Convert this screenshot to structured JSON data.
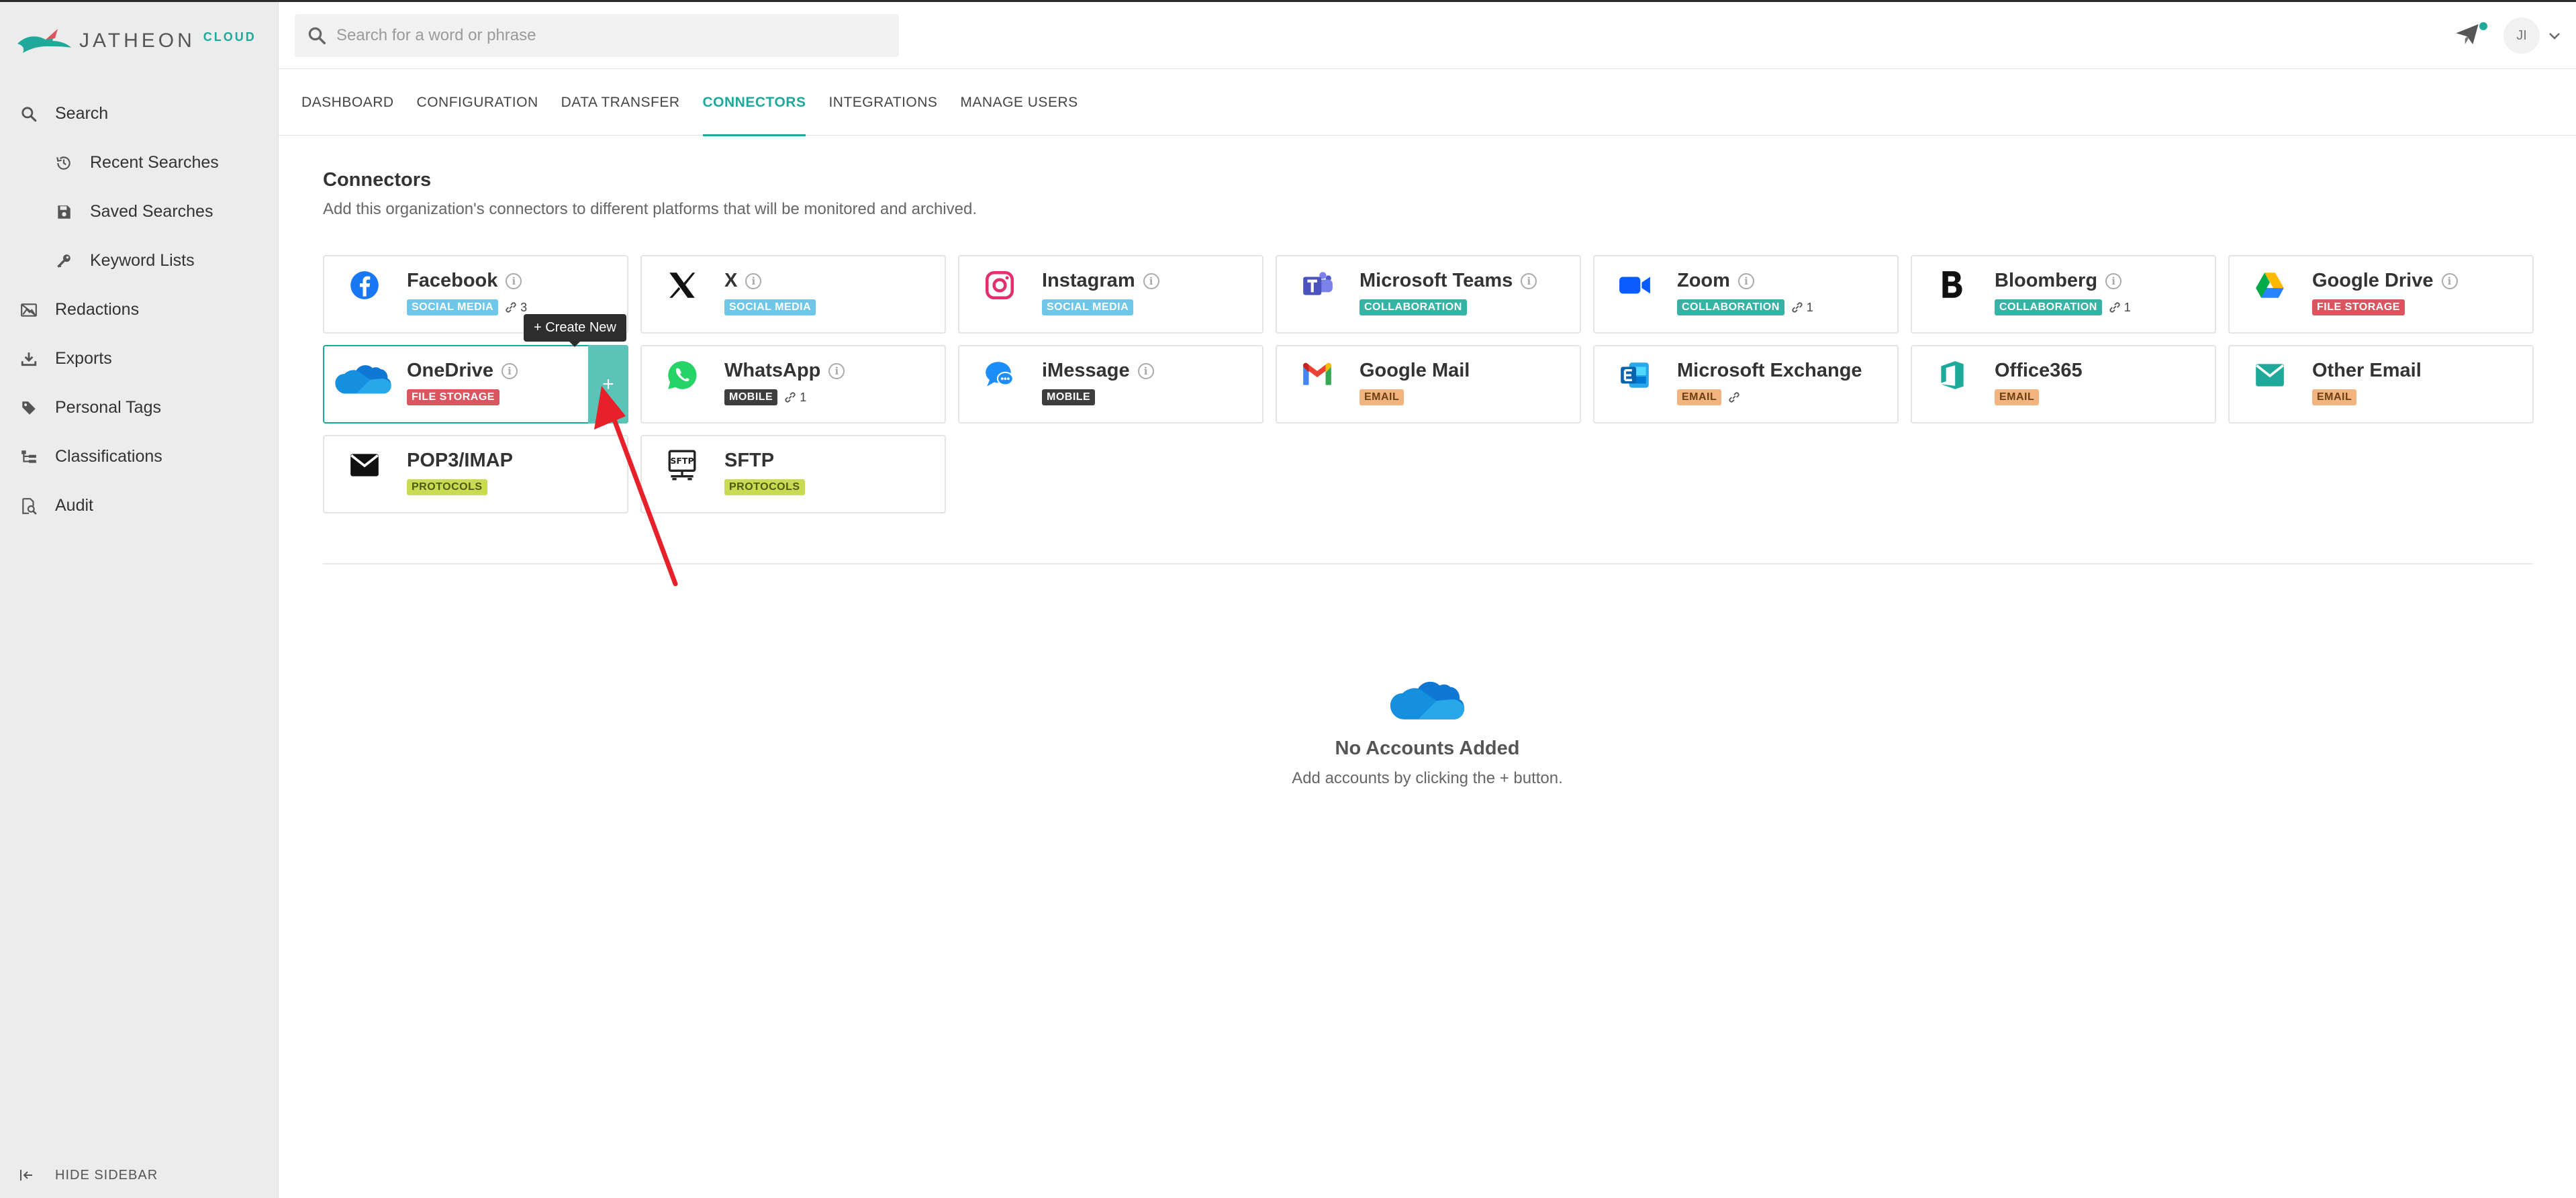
{
  "app": {
    "logo_text": "JATHEON",
    "logo_suffix": "CLOUD"
  },
  "header": {
    "search_placeholder": "Search for a word or phrase",
    "avatar_initials": "JI"
  },
  "sidebar": {
    "items": [
      {
        "label": "Search",
        "icon": "search-icon"
      },
      {
        "label": "Recent Searches",
        "icon": "history-icon"
      },
      {
        "label": "Saved Searches",
        "icon": "save-icon"
      },
      {
        "label": "Keyword Lists",
        "icon": "key-icon"
      },
      {
        "label": "Redactions",
        "icon": "redaction-icon"
      },
      {
        "label": "Exports",
        "icon": "download-icon"
      },
      {
        "label": "Personal Tags",
        "icon": "tag-icon"
      },
      {
        "label": "Classifications",
        "icon": "classification-icon"
      },
      {
        "label": "Audit",
        "icon": "audit-icon"
      }
    ],
    "hide_label": "HIDE SIDEBAR"
  },
  "tabs": [
    {
      "label": "DASHBOARD"
    },
    {
      "label": "CONFIGURATION"
    },
    {
      "label": "DATA TRANSFER"
    },
    {
      "label": "CONNECTORS"
    },
    {
      "label": "INTEGRATIONS"
    },
    {
      "label": "MANAGE USERS"
    }
  ],
  "page": {
    "title": "Connectors",
    "subtitle": "Add this organization's connectors to different platforms that will be monitored and archived."
  },
  "connectors": [
    {
      "name": "Facebook",
      "tag": "SOCIAL MEDIA",
      "links": "3",
      "icon": "facebook-icon"
    },
    {
      "name": "X",
      "tag": "SOCIAL MEDIA",
      "icon": "x-icon"
    },
    {
      "name": "Instagram",
      "tag": "SOCIAL MEDIA",
      "icon": "instagram-icon"
    },
    {
      "name": "Microsoft Teams",
      "tag": "COLLABORATION",
      "icon": "teams-icon"
    },
    {
      "name": "Zoom",
      "tag": "COLLABORATION",
      "links": "1",
      "icon": "zoom-icon"
    },
    {
      "name": "Bloomberg",
      "tag": "COLLABORATION",
      "links": "1",
      "icon": "bloomberg-icon"
    },
    {
      "name": "Google Drive",
      "tag": "FILE STORAGE",
      "icon": "google-drive-icon"
    },
    {
      "name": "OneDrive",
      "tag": "FILE STORAGE",
      "icon": "onedrive-icon"
    },
    {
      "name": "WhatsApp",
      "tag": "MOBILE",
      "links": "1",
      "icon": "whatsapp-icon"
    },
    {
      "name": "iMessage",
      "tag": "MOBILE",
      "icon": "imessage-icon"
    },
    {
      "name": "Google Mail",
      "tag": "EMAIL",
      "icon": "gmail-icon"
    },
    {
      "name": "Microsoft Exchange",
      "tag": "EMAIL",
      "icon": "exchange-icon"
    },
    {
      "name": "Office365",
      "tag": "EMAIL",
      "icon": "office365-icon"
    },
    {
      "name": "Other Email",
      "tag": "EMAIL",
      "icon": "email-icon"
    },
    {
      "name": "POP3/IMAP",
      "tag": "PROTOCOLS",
      "icon": "envelope-icon"
    },
    {
      "name": "SFTP",
      "tag": "PROTOCOLS",
      "icon": "sftp-icon"
    }
  ],
  "selected_connector": {
    "add_label": "+",
    "tooltip": "+ Create New"
  },
  "empty_state": {
    "title": "No Accounts Added",
    "subtitle": "Add accounts by clicking the + button."
  },
  "colors": {
    "accent": "#1fa99a",
    "social_media": "#6ec6e8",
    "collaboration": "#36b3a4",
    "file_storage": "#d9555f",
    "mobile": "#3e3e3e",
    "email": "#f2b47e",
    "protocols": "#c8db52",
    "annotation_arrow": "#e8202a"
  }
}
